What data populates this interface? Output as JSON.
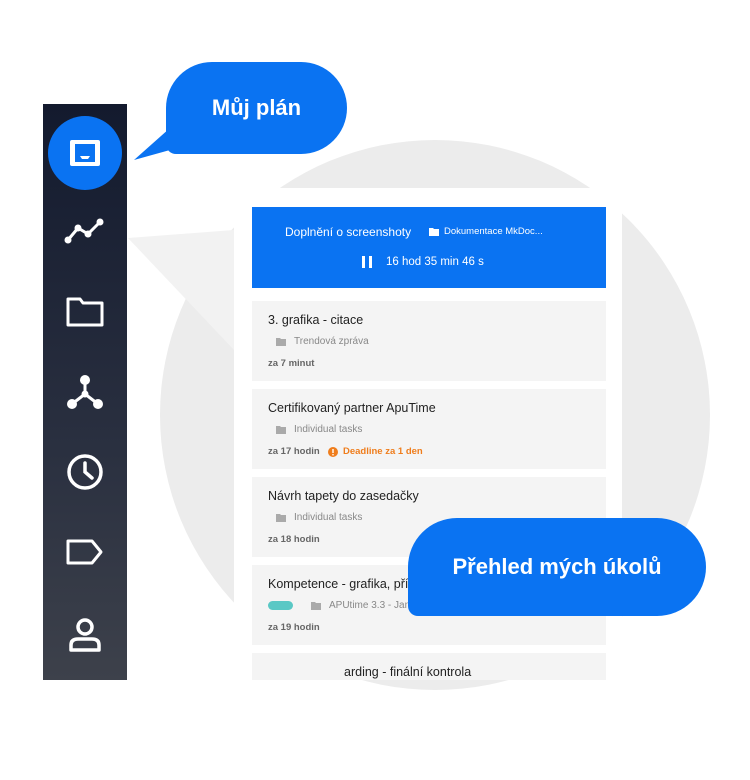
{
  "bubbles": {
    "plan": "Můj plán",
    "list": "Přehled mých úkolů"
  },
  "sidebar": {
    "items": [
      {
        "icon": "inbox-icon",
        "active": true
      },
      {
        "icon": "trend-icon"
      },
      {
        "icon": "folder-icon"
      },
      {
        "icon": "hierarchy-icon"
      },
      {
        "icon": "clock-icon"
      },
      {
        "icon": "tag-icon"
      },
      {
        "icon": "user-icon"
      }
    ]
  },
  "active_task": {
    "title": "Doplnění o screenshoty",
    "project": "Dokumentace MkDoc...",
    "timer": "16 hod 35 min 46 s"
  },
  "tasks": [
    {
      "title": "3. grafika - citace",
      "project": "Trendová zpráva",
      "due": "za 7 minut"
    },
    {
      "title": "Certifikovaný partner ApuTime",
      "project": "Individual tasks",
      "due": "za 17 hodin",
      "deadline": "Deadline za 1 den"
    },
    {
      "title": "Návrh tapety do zasedačky",
      "project": "Individual tasks",
      "due": "za 18 hodin"
    },
    {
      "title": "Kompetence - grafika, přípa",
      "project": "APUtime 3.3 - Januar...",
      "due": "za 19 hodin"
    },
    {
      "title": "arding - finální kontrola"
    }
  ],
  "colors": {
    "accent": "#0a73f2",
    "sidebar": "#131a2e",
    "deadline": "#ef7d1c",
    "tag": "#5ac8c5"
  }
}
